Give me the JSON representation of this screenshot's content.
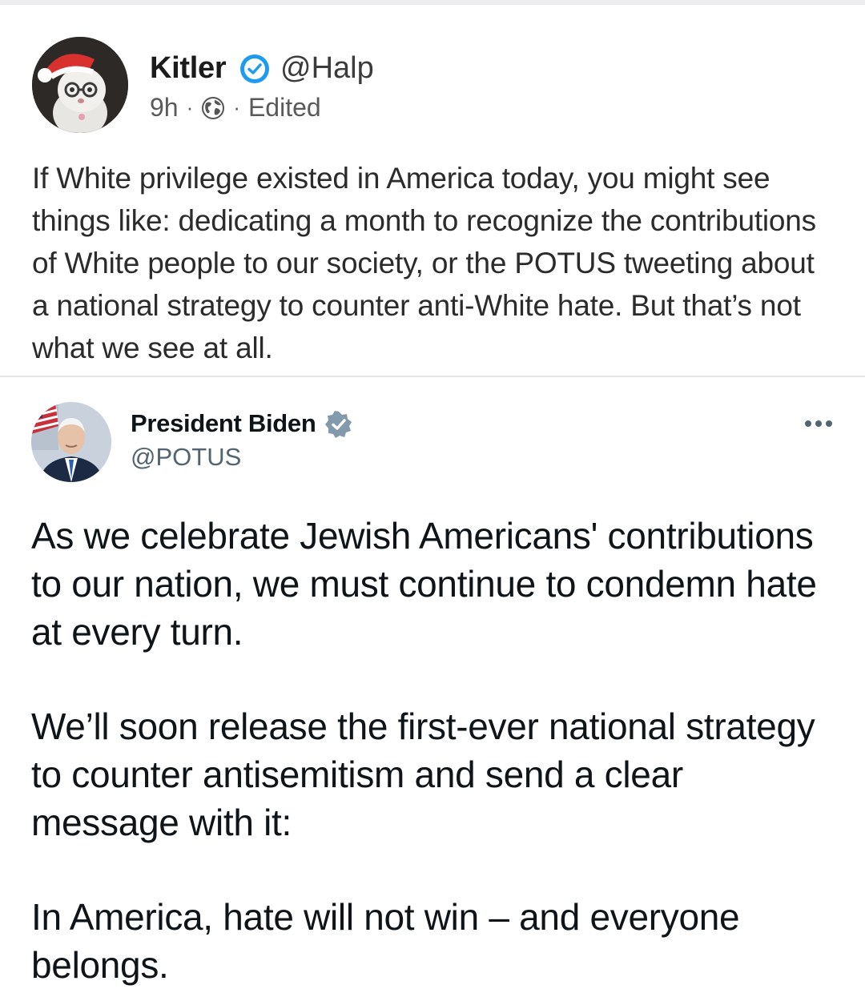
{
  "post": {
    "author": {
      "name": "Kitler",
      "handle": "@Halp",
      "avatar": "cat-santa-hat-avatar",
      "verified": true,
      "badge_color": "#1d9bf0"
    },
    "meta": {
      "time": "9h",
      "separator": "·",
      "visibility_icon": "globe-icon",
      "edited_label": "Edited"
    },
    "body": "If White privilege existed in America today, you might see things like: dedicating a month to recognize the contributions of White people to our society, or the POTUS tweeting about a national strategy to counter anti-White hate. But that’s not what we see at all."
  },
  "embedded_tweet": {
    "author": {
      "name": "President Biden",
      "handle": "@POTUS",
      "avatar": "president-portrait-avatar",
      "badge": "government-verified-badge",
      "badge_color": "#829aab"
    },
    "more_icon": "more-options-icon",
    "paragraphs": [
      "As we celebrate Jewish Americans' contributions to our nation, we must continue to condemn hate at every turn.",
      "We’ll soon release the first-ever national strategy to counter antisemitism and send a clear message with it:",
      "In America, hate will not win – and everyone belongs."
    ]
  }
}
